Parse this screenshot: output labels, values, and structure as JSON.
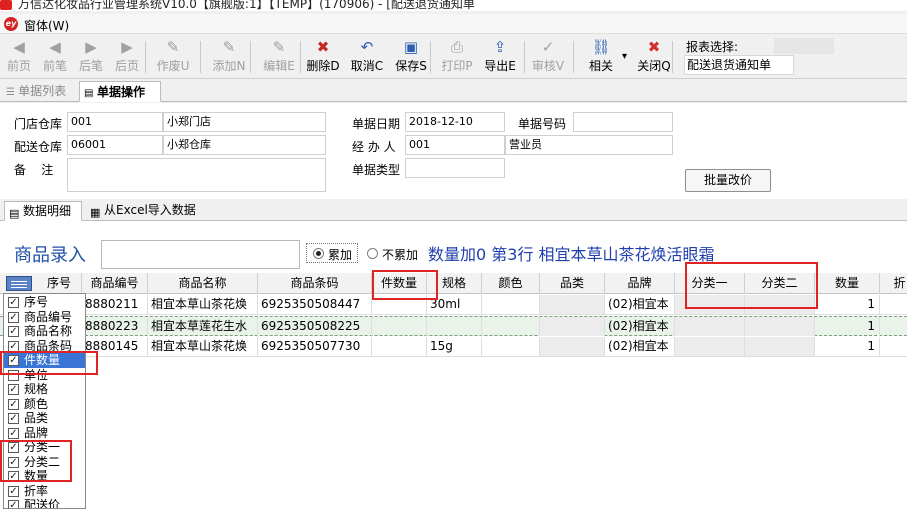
{
  "window": {
    "title": "万信达化妆品行业管理系统V10.0【旗舰版:1】【TEMP】(170906) - [配送退货通知单"
  },
  "menu": {
    "window_label": "窗体(W)"
  },
  "toolbar": {
    "buttons": [
      {
        "label": "前页",
        "icon": "◀",
        "enabled": false
      },
      {
        "label": "前笔",
        "icon": "◀",
        "enabled": false
      },
      {
        "label": "后笔",
        "icon": "▶",
        "enabled": false
      },
      {
        "label": "后页",
        "icon": "▶",
        "enabled": false
      },
      {
        "label": "作废U",
        "icon": "✎",
        "enabled": false
      },
      {
        "label": "添加N",
        "icon": "✎",
        "enabled": false
      },
      {
        "label": "编辑E",
        "icon": "✎",
        "enabled": false
      },
      {
        "label": "删除D",
        "icon": "✖",
        "enabled": true
      },
      {
        "label": "取消C",
        "icon": "↶",
        "enabled": true
      },
      {
        "label": "保存S",
        "icon": "▣",
        "enabled": true
      },
      {
        "label": "打印P",
        "icon": "⎙",
        "enabled": false
      },
      {
        "label": "导出E",
        "icon": "⇪",
        "enabled": true
      },
      {
        "label": "审核V",
        "icon": "✓",
        "enabled": false
      },
      {
        "label": "相关",
        "icon": "⛓",
        "enabled": true
      },
      {
        "label": "关闭Q",
        "icon": "✖",
        "enabled": true
      }
    ],
    "report_select_label": "报表选择:",
    "report_select_value": "配送退货通知单"
  },
  "top_tabs": {
    "list": "单据列表",
    "ops": "单据操作"
  },
  "form": {
    "store_wh_label": "门店仓库",
    "store_wh_code": "001",
    "store_wh_name": "小郑门店",
    "dist_wh_label": "配送仓库",
    "dist_wh_code": "06001",
    "dist_wh_name": "小郑仓库",
    "remark_label": "备    注",
    "date_label": "单据日期",
    "date_value": "2018-12-10",
    "number_label": "单据号码",
    "number_value": "",
    "handler_label": "经 办 人",
    "handler_code": "001",
    "handler_name": "营业员",
    "type_label": "单据类型",
    "type_value": "",
    "batch_button": "批量改价"
  },
  "sub_tabs": {
    "detail": "数据明细",
    "excel": "从Excel导入数据"
  },
  "entry": {
    "title": "商品录入",
    "radio_add": "累加",
    "radio_noadd": "不累加",
    "info": "数量加0 第3行   相宜本草山茶花焕活眼霜"
  },
  "grid": {
    "columns": [
      "序号",
      "商品编号",
      "商品名称",
      "商品条码",
      "件数量",
      "规格",
      "颜色",
      "品类",
      "品牌",
      "分类一",
      "分类二",
      "数量",
      "折"
    ],
    "rows": [
      {
        "code": "8880211",
        "name": "相宜本草山茶花焕",
        "barcode": "6925350508447",
        "pieces": "",
        "spec": "30ml",
        "color": "",
        "category": "",
        "brand": "(02)相宜本",
        "class1": "",
        "class2": "",
        "qty": "1"
      },
      {
        "code": "8880223",
        "name": "相宜本草莲花生水",
        "barcode": "6925350508225",
        "pieces": "",
        "spec": "",
        "color": "",
        "category": "",
        "brand": "(02)相宜本",
        "class1": "",
        "class2": "",
        "qty": "1"
      },
      {
        "code": "8880145",
        "name": "相宜本草山茶花焕",
        "barcode": "6925350507730",
        "pieces": "",
        "spec": "15g",
        "color": "",
        "category": "",
        "brand": "(02)相宜本",
        "class1": "",
        "class2": "",
        "qty": "1"
      }
    ]
  },
  "column_chooser": {
    "items": [
      {
        "label": "序号",
        "checked": true
      },
      {
        "label": "商品编号",
        "checked": true
      },
      {
        "label": "商品名称",
        "checked": true
      },
      {
        "label": "商品条码",
        "checked": true
      },
      {
        "label": "件数量",
        "checked": true,
        "highlighted": true
      },
      {
        "label": "单位",
        "checked": false
      },
      {
        "label": "规格",
        "checked": true
      },
      {
        "label": "颜色",
        "checked": true
      },
      {
        "label": "品类",
        "checked": true
      },
      {
        "label": "品牌",
        "checked": true
      },
      {
        "label": "分类一",
        "checked": true
      },
      {
        "label": "分类二",
        "checked": true
      },
      {
        "label": "数量",
        "checked": true
      },
      {
        "label": "折率",
        "checked": true
      },
      {
        "label": "配送价",
        "checked": true
      }
    ]
  },
  "colors": {
    "accent_blue": "#1f4fa7",
    "annotation_red": "#e02424",
    "selection_blue": "#3875d7"
  }
}
